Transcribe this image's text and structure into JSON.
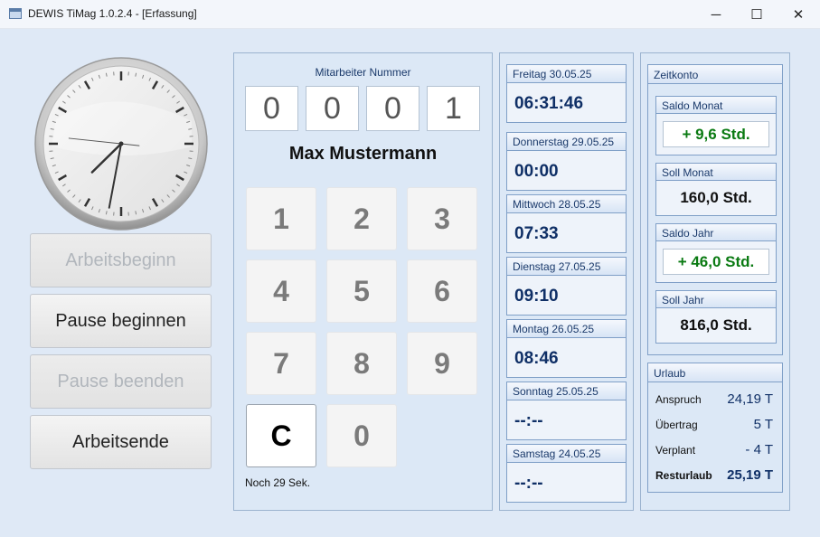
{
  "window": {
    "title": "DEWIS TiMag 1.0.2.4 - [Erfassung]",
    "icon": "app-icon",
    "controls": {
      "minimize": "─",
      "maximize": "☐",
      "close": "✕"
    }
  },
  "clock": {
    "hour": 7,
    "minute": 31,
    "second": 46
  },
  "actions": {
    "arbeitsbeginn": "Arbeitsbeginn",
    "pause_beginnen": "Pause beginnen",
    "pause_beenden": "Pause beenden",
    "arbeitsende": "Arbeitsende"
  },
  "employee": {
    "label": "Mitarbeiter Nummer",
    "digits": [
      "0",
      "0",
      "0",
      "1"
    ],
    "name": "Max Mustermann"
  },
  "keypad": [
    "1",
    "2",
    "3",
    "4",
    "5",
    "6",
    "7",
    "8",
    "9",
    "C",
    "0"
  ],
  "timeout": "Noch 29 Sek.",
  "days": [
    {
      "label": "Freitag 30.05.25",
      "value": "06:31:46"
    },
    {
      "label": "Donnerstag 29.05.25",
      "value": "00:00"
    },
    {
      "label": "Mittwoch 28.05.25",
      "value": "07:33"
    },
    {
      "label": "Dienstag 27.05.25",
      "value": "09:10"
    },
    {
      "label": "Montag 26.05.25",
      "value": "08:46"
    },
    {
      "label": "Sonntag 25.05.25",
      "value": "--:--"
    },
    {
      "label": "Samstag 24.05.25",
      "value": "--:--"
    }
  ],
  "zeitkonto": {
    "title": "Zeitkonto",
    "saldo_monat": {
      "label": "Saldo Monat",
      "value": "+ 9,6 Std."
    },
    "soll_monat": {
      "label": "Soll Monat",
      "value": "160,0 Std."
    },
    "saldo_jahr": {
      "label": "Saldo Jahr",
      "value": "+ 46,0 Std."
    },
    "soll_jahr": {
      "label": "Soll Jahr",
      "value": "816,0 Std."
    }
  },
  "urlaub": {
    "title": "Urlaub",
    "rows": [
      {
        "label": "Anspruch",
        "value": "24,19 T"
      },
      {
        "label": "Übertrag",
        "value": "5 T"
      },
      {
        "label": "Verplant",
        "value": "- 4 T"
      },
      {
        "label": "Resturlaub",
        "value": "25,19 T"
      }
    ]
  },
  "colors": {
    "accent": "#0f2f66",
    "positive": "#0a7a12",
    "panel_bg": "#dce8f6"
  }
}
